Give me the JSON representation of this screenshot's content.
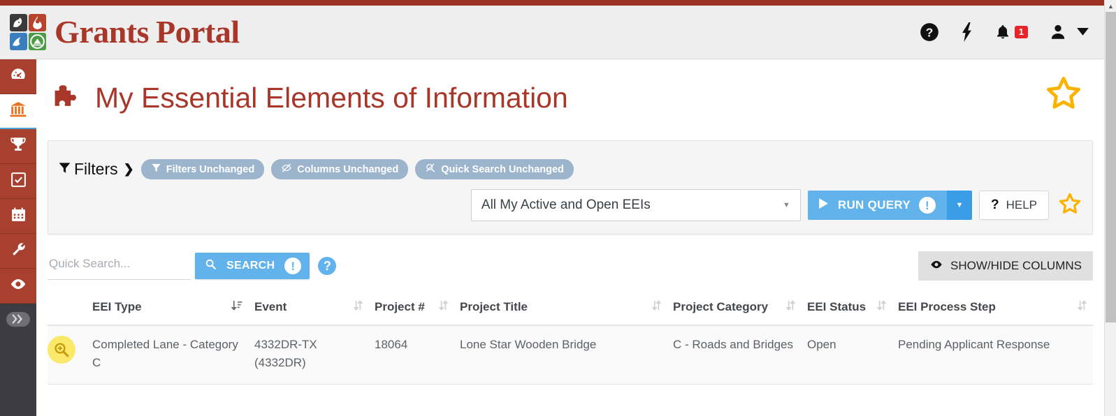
{
  "brand": {
    "name_part1": "Grants",
    "name_part2": "Portal",
    "logo_icon": "grants-portal-logo"
  },
  "header": {
    "help_icon": "question-circle-icon",
    "activity_icon": "lightning-bolt-icon",
    "notifications_icon": "bell-icon",
    "notifications_count": "1",
    "user_icon": "user-icon",
    "user_caret_icon": "caret-down-icon"
  },
  "sidebar": {
    "items": [
      {
        "name": "dashboard",
        "icon": "dashboard-gauge-icon",
        "active": false
      },
      {
        "name": "organization",
        "icon": "bank-building-icon",
        "active": true
      },
      {
        "name": "awards",
        "icon": "trophy-icon",
        "active": false
      },
      {
        "name": "tasks",
        "icon": "checkbox-check-icon",
        "active": false
      },
      {
        "name": "calendar",
        "icon": "calendar-icon",
        "active": false
      },
      {
        "name": "tools",
        "icon": "wrench-icon",
        "active": false
      },
      {
        "name": "watch",
        "icon": "eye-icon",
        "active": false
      }
    ],
    "expand_label": "»",
    "expand_icon": "double-chevron-right-icon"
  },
  "page": {
    "title": "My Essential Elements of Information",
    "title_icon": "puzzle-piece-icon",
    "favorite_icon": "star-outline-icon"
  },
  "filters": {
    "label": "Filters",
    "expand_icon": "chevron-right-icon",
    "funnel_icon": "funnel-icon",
    "pills": [
      {
        "label": "Filters Unchanged",
        "icon": "funnel-icon"
      },
      {
        "label": "Columns Unchanged",
        "icon": "columns-slash-icon"
      },
      {
        "label": "Quick Search Unchanged",
        "icon": "search-slash-icon"
      }
    ],
    "query_select": {
      "value": "All My Active and Open EEIs",
      "caret_icon": "caret-down-icon"
    },
    "run_query": {
      "label": "RUN QUERY",
      "play_icon": "play-icon",
      "info_icon": "exclamation-circle-icon",
      "dropdown_icon": "caret-down-icon"
    },
    "help": {
      "label": "HELP",
      "icon": "question-mark-icon"
    },
    "favorite_icon": "star-outline-icon"
  },
  "quick_search": {
    "placeholder": "Quick Search...",
    "value": "",
    "search_button": {
      "label": "SEARCH",
      "icon": "search-icon",
      "info_icon": "exclamation-circle-icon"
    },
    "help_icon": "question-circle-icon",
    "show_hide_columns": {
      "label": "SHOW/HIDE COLUMNS",
      "icon": "eye-icon"
    }
  },
  "table": {
    "columns": [
      {
        "key": "magnifier",
        "label": "",
        "sort": "none"
      },
      {
        "key": "eei_type",
        "label": "EEI Type",
        "sort": "active"
      },
      {
        "key": "event",
        "label": "Event",
        "sort": "both"
      },
      {
        "key": "project_num",
        "label": "Project #",
        "sort": "both"
      },
      {
        "key": "project_title",
        "label": "Project Title",
        "sort": "both"
      },
      {
        "key": "project_category",
        "label": "Project Category",
        "sort": "both"
      },
      {
        "key": "eei_status",
        "label": "EEI Status",
        "sort": "both"
      },
      {
        "key": "eei_process_step",
        "label": "EEI Process Step",
        "sort": "both"
      }
    ],
    "rows": [
      {
        "magnifier_icon": "magnifier-plus-icon",
        "eei_type": "Completed Lane - Category C",
        "event": "4332DR-TX (4332DR)",
        "project_num": "18064",
        "project_title": "Lone Star Wooden Bridge",
        "project_category": "C - Roads and Bridges",
        "eei_status": "Open",
        "eei_process_step": "Pending Applicant Response"
      }
    ]
  },
  "scrollbar": {
    "up_arrow_icon": "chevron-up-icon"
  },
  "colors": {
    "brand_red": "#a8372a",
    "top_strip": "#9c3224",
    "sidebar_red": "#a8402f",
    "sidebar_dark": "#3c3c42",
    "accent_blue": "#62b3ec",
    "accent_blue_dark": "#3a9ee6",
    "pill_blue": "#9cb4cc",
    "badge_red": "#e8232a",
    "star_gold": "#fbb300",
    "magnifier_yellow": "#fbe96b"
  }
}
